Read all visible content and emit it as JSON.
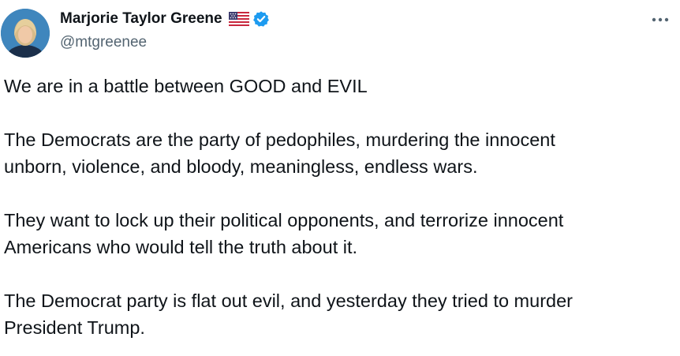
{
  "author": {
    "display_name": "Marjorie Taylor Greene",
    "handle": "@mtgreenee",
    "flag_icon": "us-flag-icon",
    "verified_icon": "verified-badge-icon",
    "verified_color": "#1d9bf0"
  },
  "actions": {
    "more_icon": "more-options-icon"
  },
  "tweet": {
    "paragraphs": [
      {
        "lines": [
          "We are in a battle between GOOD and EVIL"
        ]
      },
      {
        "lines": [
          "The Democrats are the party of pedophiles, murdering the innocent",
          "unborn, violence, and bloody, meaningless, endless wars."
        ]
      },
      {
        "lines": [
          "They want to lock up their political opponents, and terrorize innocent",
          "Americans who would tell the truth about it."
        ]
      },
      {
        "lines": [
          "The Democrat party is flat out evil, and yesterday they tried to murder",
          "President Trump."
        ]
      }
    ]
  },
  "colors": {
    "text_primary": "#0f1419",
    "text_secondary": "#536471",
    "accent": "#1d9bf0"
  }
}
